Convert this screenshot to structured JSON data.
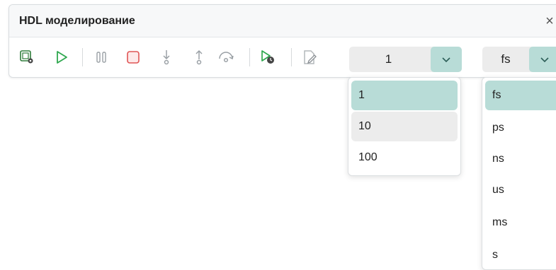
{
  "window": {
    "title": "HDL моделирование",
    "close_glyph": "×"
  },
  "toolbar": {
    "icons": [
      "settings-chip-icon",
      "run-icon",
      "pause-icon",
      "stop-icon",
      "step-into-icon",
      "step-out-icon",
      "step-over-icon",
      "run-timed-icon",
      "edit-file-icon"
    ],
    "step_combo": {
      "value": "1",
      "options": [
        "1",
        "10",
        "100"
      ],
      "selected_index": 0,
      "hover_index": 1
    },
    "unit_combo": {
      "value": "fs",
      "options": [
        "fs",
        "ps",
        "ns",
        "us",
        "ms",
        "s"
      ],
      "selected_index": 0
    }
  },
  "colors": {
    "accent": "#b8dcd7",
    "run_green": "#2fa84f",
    "stop_red": "#e05555",
    "icon_gray": "#8a8f94"
  }
}
